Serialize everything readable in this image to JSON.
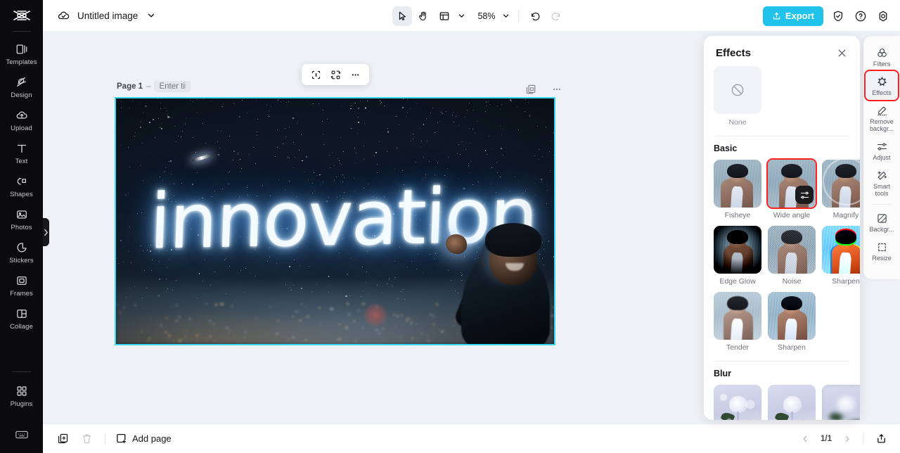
{
  "app": {
    "logo_icon": "capcut-logo-icon"
  },
  "left_sidebar": {
    "items": [
      {
        "label": "Templates",
        "icon": "templates-icon"
      },
      {
        "label": "Design",
        "icon": "design-icon"
      },
      {
        "label": "Upload",
        "icon": "upload-cloud-icon"
      },
      {
        "label": "Text",
        "icon": "text-icon"
      },
      {
        "label": "Shapes",
        "icon": "shapes-icon"
      },
      {
        "label": "Photos",
        "icon": "photos-icon"
      },
      {
        "label": "Stickers",
        "icon": "stickers-icon"
      },
      {
        "label": "Frames",
        "icon": "frames-icon"
      },
      {
        "label": "Collage",
        "icon": "collage-icon"
      },
      {
        "label": "Plugins",
        "icon": "plugins-icon"
      }
    ],
    "bottom_icon": "keyboard-shortcuts-icon",
    "collapse_icon": "chevron-right-icon"
  },
  "topbar": {
    "cloud_icon": "cloud-saved-icon",
    "doc_title": "Untitled image",
    "title_caret_icon": "chevron-down-icon",
    "select_tool_icon": "cursor-arrow-icon",
    "hand_tool_icon": "hand-icon",
    "layout_tool_icon": "layout-panel-icon",
    "layout_caret_icon": "chevron-down-icon",
    "zoom_value": "58%",
    "zoom_caret_icon": "chevron-down-icon",
    "undo_icon": "undo-icon",
    "redo_icon": "redo-icon",
    "export_label": "Export",
    "export_icon": "export-upload-icon",
    "export_color": "#21c3ea",
    "shield_icon": "shield-check-icon",
    "help_icon": "help-circle-icon",
    "settings_icon": "settings-gear-icon"
  },
  "canvas": {
    "page_label": "Page 1",
    "page_dash": "–",
    "page_title_placeholder": "Enter title",
    "float_toolbar": {
      "crop_icon": "crop-select-icon",
      "replace_icon": "swap-layout-icon",
      "more_icon": "more-horizontal-icon"
    },
    "actions": {
      "duplicate_icon": "duplicate-page-icon",
      "more_icon": "more-horizontal-icon"
    },
    "image": {
      "neon_text": "innovation",
      "selection_color": "#3ad8ef"
    }
  },
  "effects_panel": {
    "title": "Effects",
    "close_icon": "close-x-icon",
    "none": {
      "label": "None",
      "icon": "no-effect-icon"
    },
    "sections": [
      {
        "title": "Basic",
        "items": [
          {
            "label": "Fisheye",
            "selected": false,
            "style": "fisheye"
          },
          {
            "label": "Wide angle",
            "selected": true,
            "style": "wide",
            "badge_icon": "adjust-sliders-icon"
          },
          {
            "label": "Magnify",
            "selected": false,
            "style": "magnify"
          },
          {
            "label": "Edge Glow",
            "selected": false,
            "style": "edge"
          },
          {
            "label": "Noise",
            "selected": false,
            "style": "noise"
          },
          {
            "label": "Sharpen",
            "selected": false,
            "style": "sharpen1"
          },
          {
            "label": "Tender",
            "selected": false,
            "style": "tender"
          },
          {
            "label": "Sharpen",
            "selected": false,
            "style": "sharpen2"
          }
        ]
      },
      {
        "title": "Blur",
        "items": [
          {
            "label": "",
            "selected": false,
            "style": "b1"
          },
          {
            "label": "",
            "selected": false,
            "style": "b2"
          },
          {
            "label": "",
            "selected": false,
            "style": "b3"
          }
        ]
      }
    ],
    "selection_color": "#ff1f1f"
  },
  "right_rail": {
    "items": [
      {
        "label": "Filters",
        "icon": "filters-icon",
        "highlight": false
      },
      {
        "label": "Effects",
        "icon": "effects-star-icon",
        "highlight": true
      },
      {
        "label": "Remove backgr...",
        "icon": "remove-background-icon",
        "highlight": false
      },
      {
        "label": "Adjust",
        "icon": "adjust-sliders-icon",
        "highlight": false
      },
      {
        "label": "Smart tools",
        "icon": "smart-tools-wand-icon",
        "highlight": false
      },
      {
        "label": "Backgr...",
        "icon": "background-icon",
        "highlight": false
      },
      {
        "label": "Resize",
        "icon": "resize-icon",
        "highlight": false
      }
    ]
  },
  "bottombar": {
    "duplicate_icon": "duplicate-icon",
    "delete_icon": "trash-icon",
    "add_page_label": "Add page",
    "add_page_icon": "add-page-icon",
    "prev_icon": "chevron-left-icon",
    "next_icon": "chevron-right-icon",
    "pager": "1/1",
    "export_tray_icon": "export-tray-icon"
  }
}
